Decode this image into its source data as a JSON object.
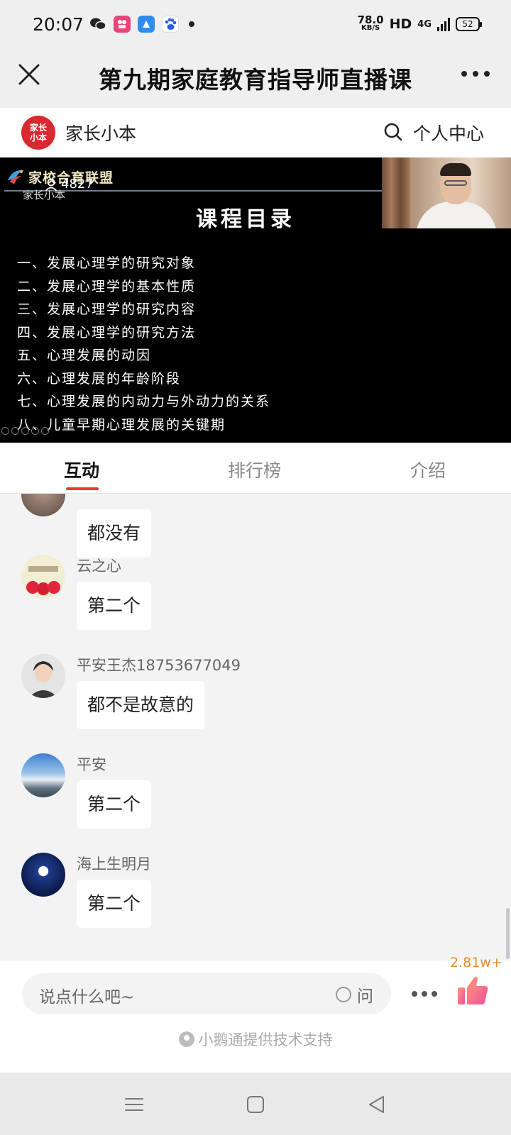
{
  "status_bar": {
    "time": "20:07",
    "net_speed": "78.0",
    "net_speed_unit": "KB/S",
    "hd": "HD",
    "network": "4G",
    "battery": "52"
  },
  "titlebar": {
    "title": "第九期家庭教育指导师直播课"
  },
  "brand": {
    "logo_text": "家长小本",
    "name": "家长小本",
    "user_center": "个人中心"
  },
  "video": {
    "org_name": "家校合育联盟",
    "viewer_count": "4827",
    "subtitle": "家长小本",
    "heading": "课程目录",
    "toc": [
      "一、发展心理学的研究对象",
      "二、发展心理学的基本性质",
      "三、发展心理学的研究内容",
      "四、发展心理学的研究方法",
      "五、心理发展的动因",
      "六、心理发展的年龄阶段",
      "七、心理发展的内动力与外动力的关系",
      "八、儿童早期心理发展的关键期"
    ]
  },
  "tabs": [
    {
      "label": "互动",
      "active": true
    },
    {
      "label": "排行榜",
      "active": false
    },
    {
      "label": "介绍",
      "active": false
    }
  ],
  "chat": {
    "messages": [
      {
        "name": "",
        "text": "都没有",
        "avatar": "avatar-cut"
      },
      {
        "name": "云之心",
        "text": "第二个",
        "avatar": "avatar-hearts"
      },
      {
        "name": "平安王杰18753677049",
        "text": "都不是故意的",
        "avatar": "avatar-woman"
      },
      {
        "name": "平安",
        "text": "第二个",
        "avatar": "avatar-sky"
      },
      {
        "name": "海上生明月",
        "text": "第二个",
        "avatar": "avatar-moon"
      }
    ]
  },
  "input": {
    "placeholder": "说点什么吧~",
    "ask_label": "问",
    "like_count": "2.81w+",
    "powered_by": "小鹅通提供技术支持"
  },
  "colors": {
    "accent_red": "#e8363a",
    "like_orange": "#e98a2a",
    "brand_red": "#d8292f"
  }
}
